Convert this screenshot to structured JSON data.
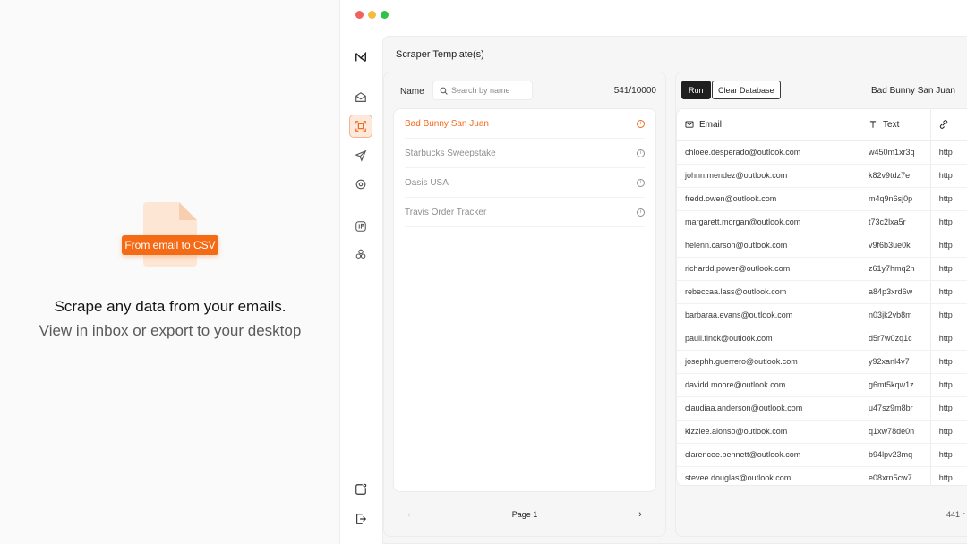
{
  "promo": {
    "badge": "From email to CSV",
    "title": "Scrape any data from your emails.",
    "subtitle": "View in inbox or export to your desktop"
  },
  "window": {
    "page_title": "Scraper Template(s)"
  },
  "rail": {
    "icons": [
      "logo-icon",
      "inbox-icon",
      "scraper-icon",
      "send-icon",
      "eye-icon",
      "ip-icon",
      "integration-icon",
      "new-window-icon",
      "logout-icon"
    ],
    "active": "scraper-icon"
  },
  "templates": {
    "name_label": "Name",
    "search_placeholder": "Search by name",
    "count": "541/10000",
    "items": [
      {
        "label": "Bad Bunny San Juan",
        "active": true
      },
      {
        "label": "Starbucks Sweepstake",
        "active": false
      },
      {
        "label": "Oasis USA",
        "active": false
      },
      {
        "label": "Travis Order Tracker",
        "active": false
      }
    ],
    "page_label": "Page 1"
  },
  "database": {
    "run_label": "Run",
    "clear_label": "Clear Database",
    "title": "Bad Bunny San Juan",
    "columns": {
      "email": "Email",
      "text": "Text"
    },
    "rows": [
      {
        "email": "chloee.desperado@outlook.com",
        "text": "w450m1xr3q",
        "link": "http"
      },
      {
        "email": "johnn.mendez@outlook.com",
        "text": "k82v9tdz7e",
        "link": "http"
      },
      {
        "email": "fredd.owen@outlook.com",
        "text": "m4q9n6sj0p",
        "link": "http"
      },
      {
        "email": "margarett.morgan@outlook.com",
        "text": "t73c2lxa5r",
        "link": "http"
      },
      {
        "email": "helenn.carson@outlook.com",
        "text": "v9f6b3ue0k",
        "link": "http"
      },
      {
        "email": "richardd.power@outlook.com",
        "text": "z61y7hmq2n",
        "link": "http"
      },
      {
        "email": "rebeccaa.lass@outlook.com",
        "text": "a84p3xrd6w",
        "link": "http"
      },
      {
        "email": "barbaraa.evans@outlook.com",
        "text": "n03jk2vb8m",
        "link": "http"
      },
      {
        "email": "paull.finck@outlook.com",
        "text": "d5r7w0zq1c",
        "link": "http"
      },
      {
        "email": "josephh.guerrero@outlook.com",
        "text": "y92xanl4v7",
        "link": "http"
      },
      {
        "email": "davidd.moore@outlook.com",
        "text": "g6mt5kqw1z",
        "link": "http"
      },
      {
        "email": "claudiaa.anderson@outlook.com",
        "text": "u47sz9m8br",
        "link": "http"
      },
      {
        "email": "kizziee.alonso@outlook.com",
        "text": "q1xw78de0n",
        "link": "http"
      },
      {
        "email": "clarencee.bennett@outlook.com",
        "text": "b94lpv23mq",
        "link": "http"
      },
      {
        "email": "stevee.douglas@outlook.com",
        "text": "e08xrn5cw7",
        "link": "http"
      }
    ],
    "footer_count": "441 r"
  },
  "colors": {
    "accent": "#f26b1d",
    "badge_bg": "#f46a15"
  }
}
